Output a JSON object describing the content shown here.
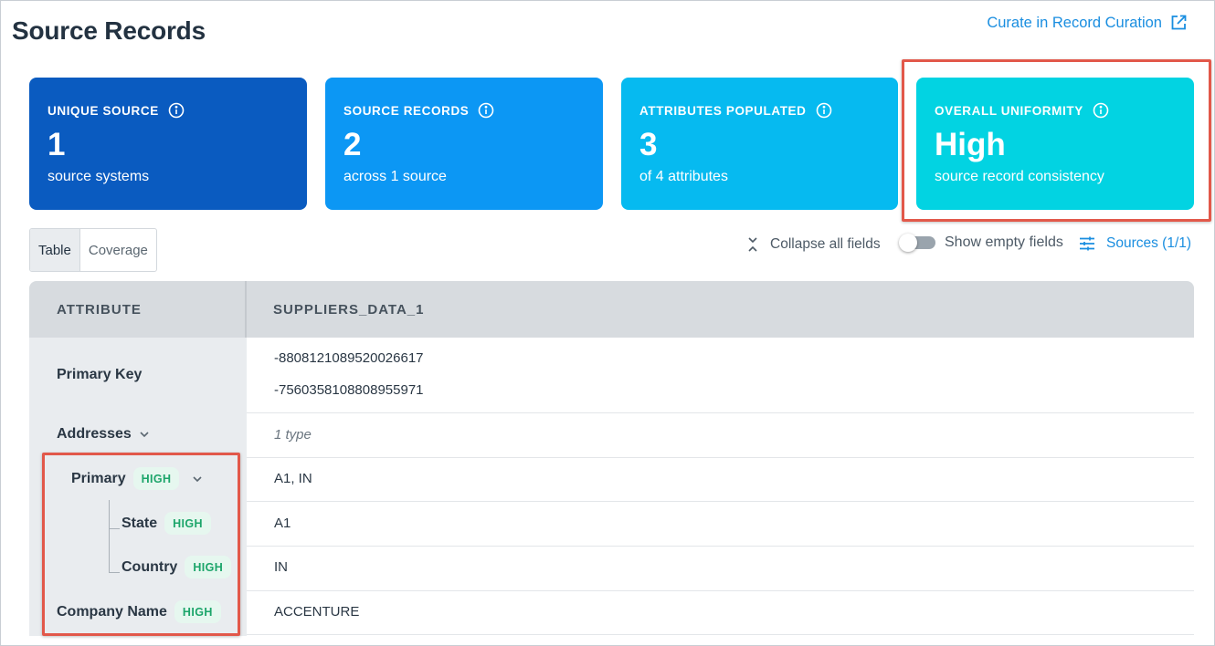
{
  "header": {
    "title": "Source Records",
    "curate_link": "Curate in Record Curation",
    "curate_icon": "external-link-icon"
  },
  "cards": [
    {
      "title": "UNIQUE SOURCE",
      "value": "1",
      "sub": "source systems",
      "color": "#0a5bc0"
    },
    {
      "title": "SOURCE RECORDS",
      "value": "2",
      "sub": "across 1 source",
      "color": "#0c97f4"
    },
    {
      "title": "ATTRIBUTES POPULATED",
      "value": "3",
      "sub": "of 4 attributes",
      "color": "#06baf0"
    },
    {
      "title": "OVERALL UNIFORMITY",
      "value": "High",
      "sub": "source record consistency",
      "color": "#02d3e2"
    }
  ],
  "view_tabs": [
    {
      "label": "Table",
      "active": true
    },
    {
      "label": "Coverage",
      "active": false
    }
  ],
  "toolbar": {
    "collapse_label": "Collapse all fields",
    "show_empty_label": "Show empty fields",
    "show_empty_on": false,
    "sources_label": "Sources (1/1)"
  },
  "table": {
    "columns": [
      "ATTRIBUTE",
      "SUPPLIERS_DATA_1"
    ],
    "rows": {
      "primary_key": {
        "label": "Primary Key",
        "values": [
          "-8808121089520026617",
          "-7560358108808955971"
        ]
      },
      "addresses": {
        "label": "Addresses",
        "value": "1 type"
      },
      "primary": {
        "label": "Primary",
        "badge": "HIGH",
        "value": "A1, IN"
      },
      "state": {
        "label": "State",
        "badge": "HIGH",
        "value": "A1"
      },
      "country": {
        "label": "Country",
        "badge": "HIGH",
        "value": "IN"
      },
      "company_name": {
        "label": "Company Name",
        "badge": "HIGH",
        "value": "ACCENTURE"
      }
    }
  },
  "colors": {
    "accent_link": "#1a8ee0",
    "highlight": "#e2584a",
    "badge_text": "#1ca56a",
    "badge_bg": "#e6f7ef"
  }
}
